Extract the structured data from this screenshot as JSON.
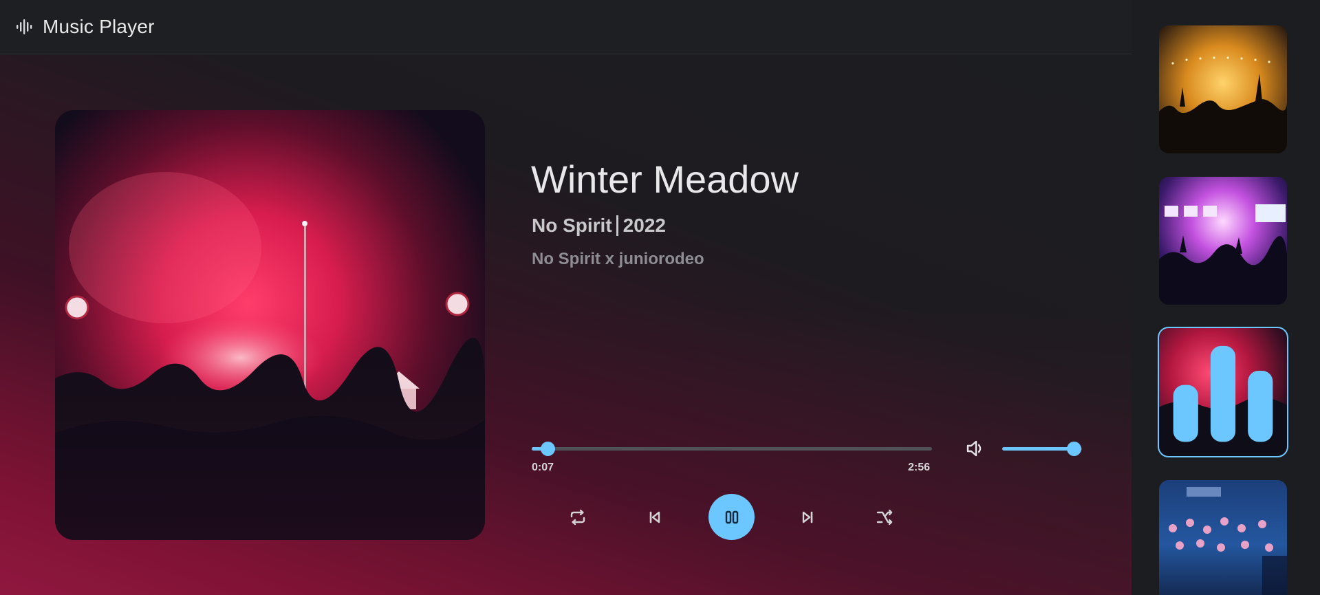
{
  "app": {
    "title": "Music Player",
    "logo_icon": "waveform-icon"
  },
  "now_playing": {
    "title": "Winter Meadow",
    "artist": "No Spirit",
    "year": "2022",
    "credits": "No Spirit x juniorodeo",
    "album_art_icon": "concert-crowd-red-image"
  },
  "progress": {
    "current_time": "0:07",
    "total_time": "2:56",
    "fraction": 0.04
  },
  "volume": {
    "icon": "speaker-volume-icon",
    "level": 0.9
  },
  "controls": {
    "repeat_icon": "repeat-icon",
    "previous_icon": "skip-previous-icon",
    "play_pause_icon": "pause-icon",
    "next_icon": "skip-next-icon",
    "shuffle_icon": "shuffle-icon",
    "state": "playing"
  },
  "playlist": [
    {
      "image": "concert-crowd-golden-image",
      "active": false
    },
    {
      "image": "concert-stage-purple-image",
      "active": false
    },
    {
      "image": "concert-crowd-red-image",
      "active": true,
      "indicator": "equalizer-icon"
    },
    {
      "image": "concert-crowd-blue-image",
      "active": false
    }
  ],
  "colors": {
    "accent": "#6cc6ff",
    "background": "#1c1d20",
    "gradient_end": "#8e1840"
  }
}
